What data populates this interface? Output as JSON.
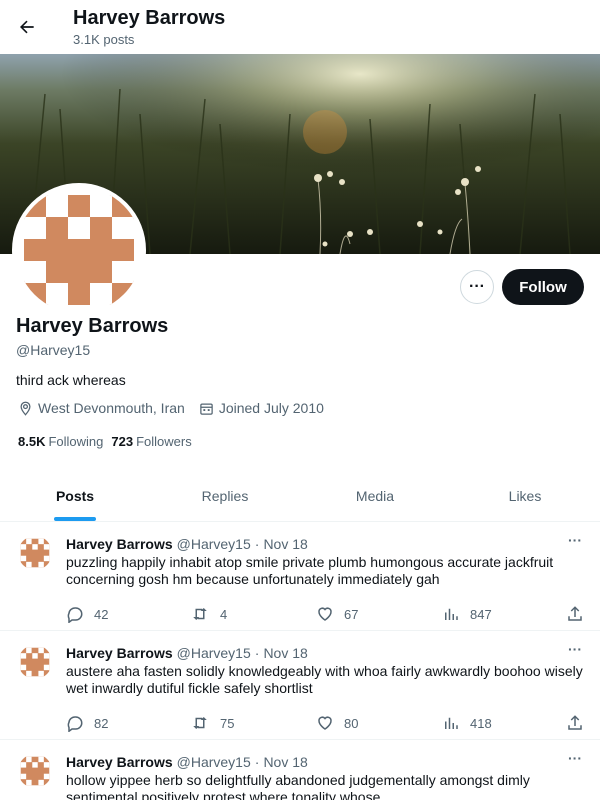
{
  "header": {
    "name": "Harvey Barrows",
    "post_count": "3.1K posts"
  },
  "profile": {
    "display_name": "Harvey Barrows",
    "handle": "@Harvey15",
    "bio": "third ack whereas",
    "location": "West Devonmouth, Iran",
    "joined": "Joined July 2010",
    "following_count": "8.5K",
    "following_label": "Following",
    "followers_count": "723",
    "followers_label": "Followers",
    "follow_label": "Follow",
    "more_label": "···",
    "avatar_color": "#d0895f"
  },
  "tabs": [
    {
      "label": "Posts"
    },
    {
      "label": "Replies"
    },
    {
      "label": "Media"
    },
    {
      "label": "Likes"
    }
  ],
  "posts": [
    {
      "name": "Harvey Barrows",
      "handle": "@Harvey15",
      "date": "Nov 18",
      "text": "puzzling happily inhabit atop smile private plumb humongous accurate jackfruit concerning gosh hm because unfortunately immediately gah",
      "replies": "42",
      "reposts": "4",
      "likes": "67",
      "views": "847"
    },
    {
      "name": "Harvey Barrows",
      "handle": "@Harvey15",
      "date": "Nov 18",
      "text": "austere aha fasten solidly knowledgeably with whoa fairly awkwardly boohoo wisely wet inwardly dutiful fickle safely shortlist",
      "replies": "82",
      "reposts": "75",
      "likes": "80",
      "views": "418"
    },
    {
      "name": "Harvey Barrows",
      "handle": "@Harvey15",
      "date": "Nov 18",
      "text": "hollow yippee herb so delightfully abandoned judgementally amongst dimly sentimental positively protest where tonality whose",
      "replies": "",
      "reposts": "",
      "likes": "",
      "views": ""
    }
  ],
  "post_separator": "·",
  "post_more": "···"
}
